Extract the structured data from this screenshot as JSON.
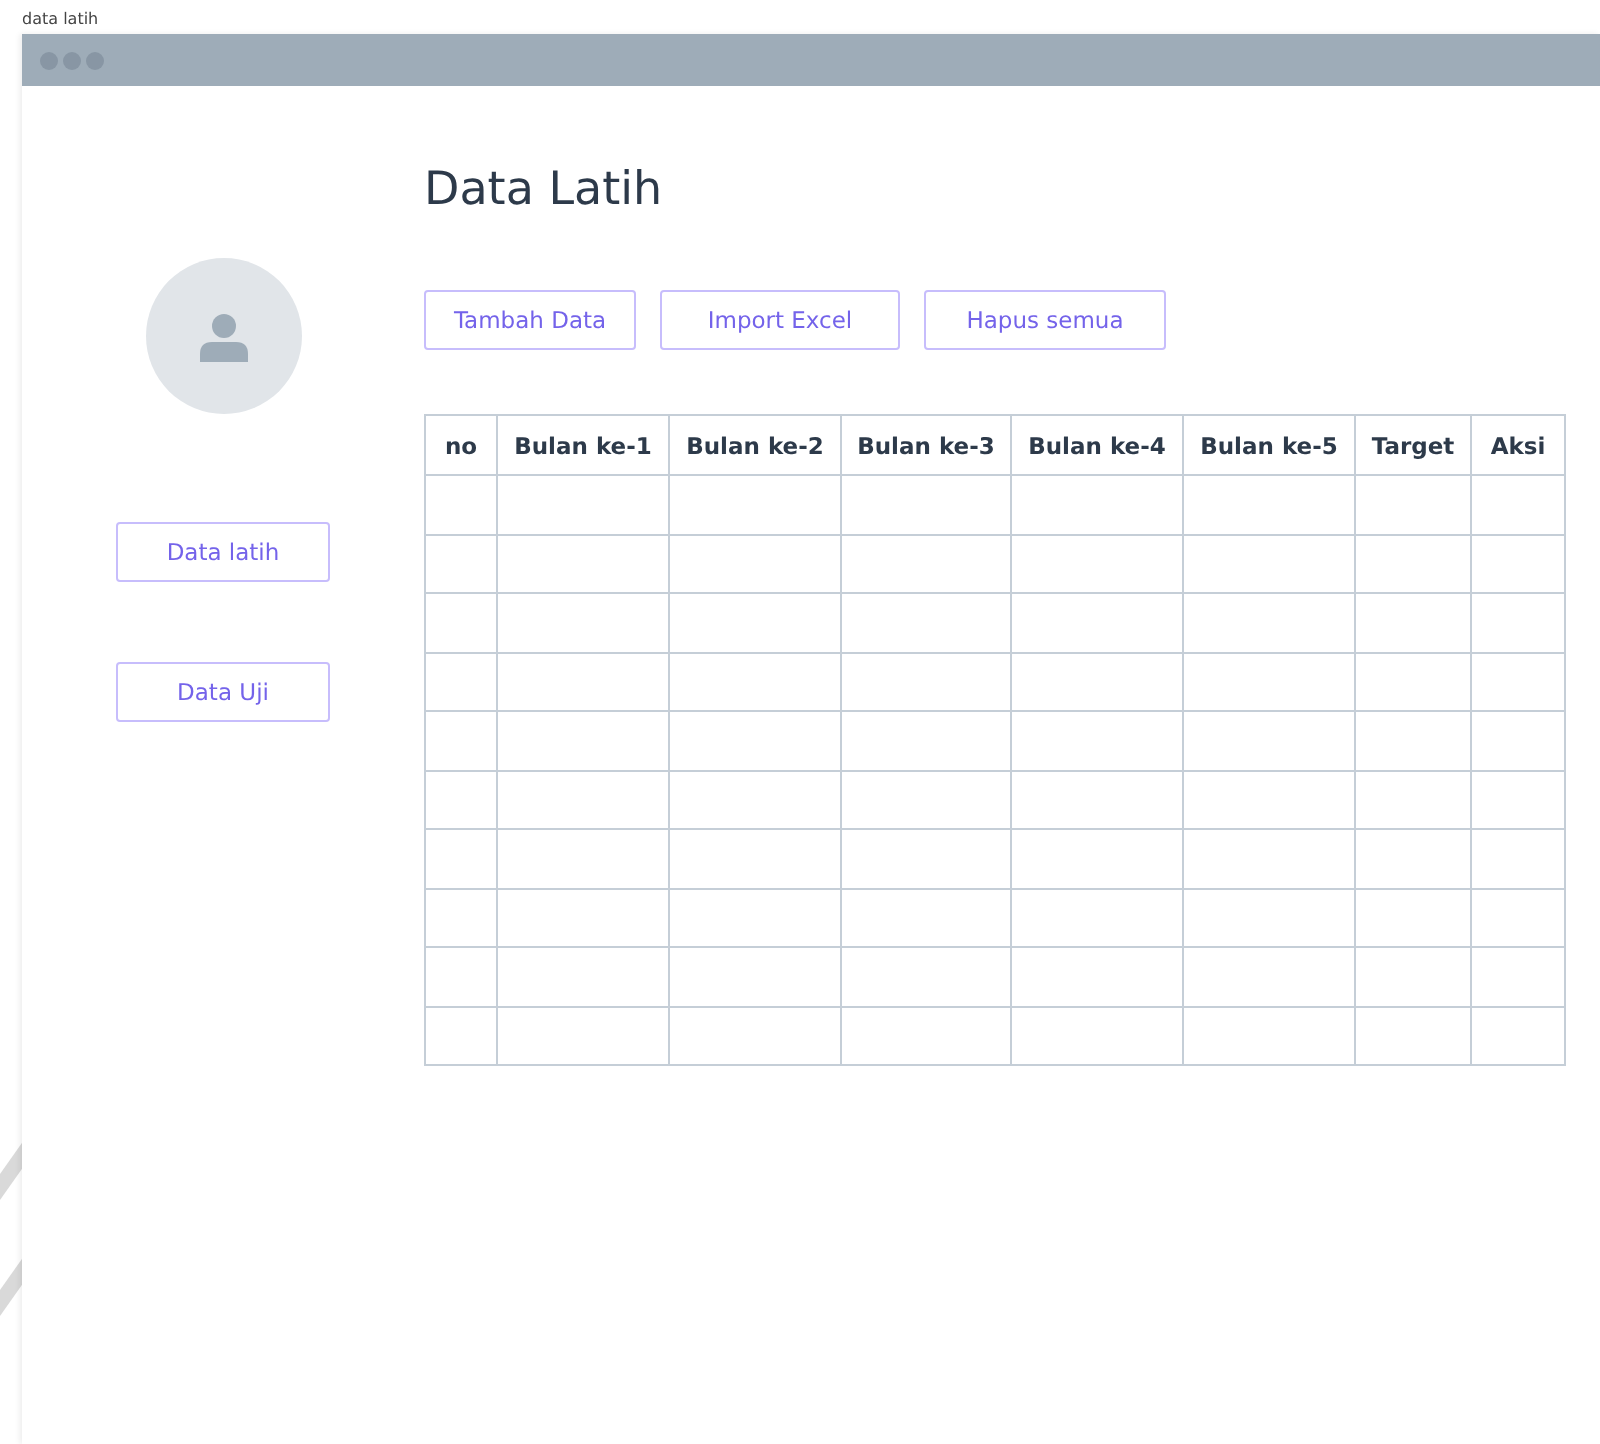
{
  "frame_label": "data latih",
  "sidebar": {
    "items": [
      {
        "label": "Data latih"
      },
      {
        "label": "Data Uji"
      }
    ]
  },
  "page_title": "Data Latih",
  "toolbar": {
    "buttons": [
      "Tambah Data",
      "Import Excel",
      "Hapus semua"
    ]
  },
  "table": {
    "columns": [
      "no",
      "Bulan ke-1",
      "Bulan ke-2",
      "Bulan ke-3",
      "Bulan ke-4",
      "Bulan ke-5",
      "Target",
      "Aksi"
    ],
    "rows": [
      {
        "kind": "blank"
      },
      {
        "kind": "blank"
      },
      {
        "kind": "blank"
      },
      {
        "kind": "blank"
      },
      {
        "kind": "blank"
      },
      {
        "kind": "blank"
      },
      {
        "kind": "blank"
      },
      {
        "kind": "blank"
      },
      {
        "kind": "blank"
      },
      {
        "kind": "blank"
      }
    ]
  }
}
